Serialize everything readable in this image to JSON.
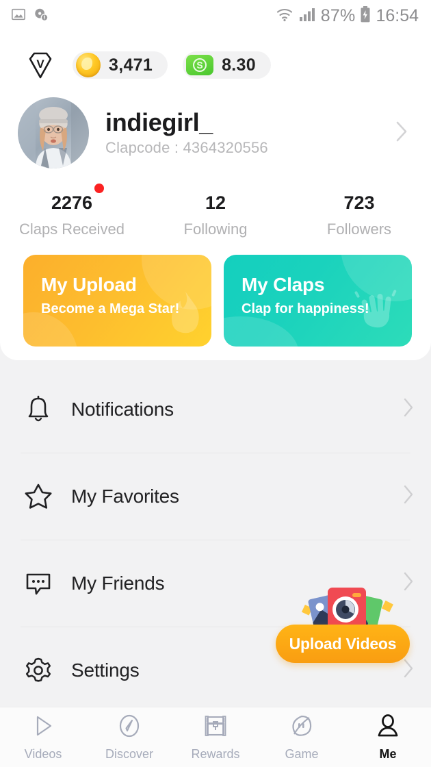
{
  "status_bar": {
    "icons_left": [
      "image-icon",
      "dns-warning-icon"
    ],
    "wifi": "wifi-icon",
    "signal": "signal-icon",
    "battery_text": "87%",
    "battery": "battery-charging-icon",
    "clock": "16:54"
  },
  "wallet": {
    "vip_badge": "vip-diamond-icon",
    "coin_icon": "gold-coin-icon",
    "coin_value": "3,471",
    "cash_icon": "cash-bill-icon",
    "cash_symbol": "S",
    "cash_value": "8.30"
  },
  "profile": {
    "avatar": "user-avatar",
    "username": "indiegirl_",
    "clapcode_label": "Clapcode : 4364320556",
    "chevron": "chevron-right-icon",
    "has_badge_dot": true
  },
  "stats": [
    {
      "value": "2276",
      "label": "Claps Received",
      "dot": true
    },
    {
      "value": "12",
      "label": "Following",
      "dot": false
    },
    {
      "value": "723",
      "label": "Followers",
      "dot": false
    }
  ],
  "action_cards": [
    {
      "title": "My Upload",
      "subtitle": "Become a Mega Star!",
      "icon": "flame-icon",
      "glyph": "🔥",
      "color": "#fcaf2c"
    },
    {
      "title": "My Claps",
      "subtitle": "Clap for happiness!",
      "icon": "clapping-hands-icon",
      "glyph": "👏",
      "color": "#14cfbe"
    }
  ],
  "menu": [
    {
      "label": "Notifications",
      "icon": "bell-icon"
    },
    {
      "label": "My Favorites",
      "icon": "star-icon"
    },
    {
      "label": "My Friends",
      "icon": "chat-bubble-icon"
    },
    {
      "label": "Settings",
      "icon": "gear-icon"
    }
  ],
  "fab": {
    "label": "Upload Videos",
    "icon": "camera-photos-icon",
    "color": "#ffb416"
  },
  "bottom_nav": {
    "items": [
      {
        "label": "Videos",
        "icon": "play-triangle-icon",
        "active": false
      },
      {
        "label": "Discover",
        "icon": "compass-icon",
        "active": false
      },
      {
        "label": "Rewards",
        "icon": "treasure-chest-icon",
        "active": false
      },
      {
        "label": "Game",
        "icon": "game-face-icon",
        "active": false
      },
      {
        "label": "Me",
        "icon": "person-icon",
        "active": true
      }
    ]
  },
  "colors": {
    "accent_orange": "#fcaf2c",
    "accent_teal": "#14cfbe",
    "badge_red": "#fb2222",
    "page_bg": "#f2f2f3",
    "card_bg": "#ffffff"
  }
}
